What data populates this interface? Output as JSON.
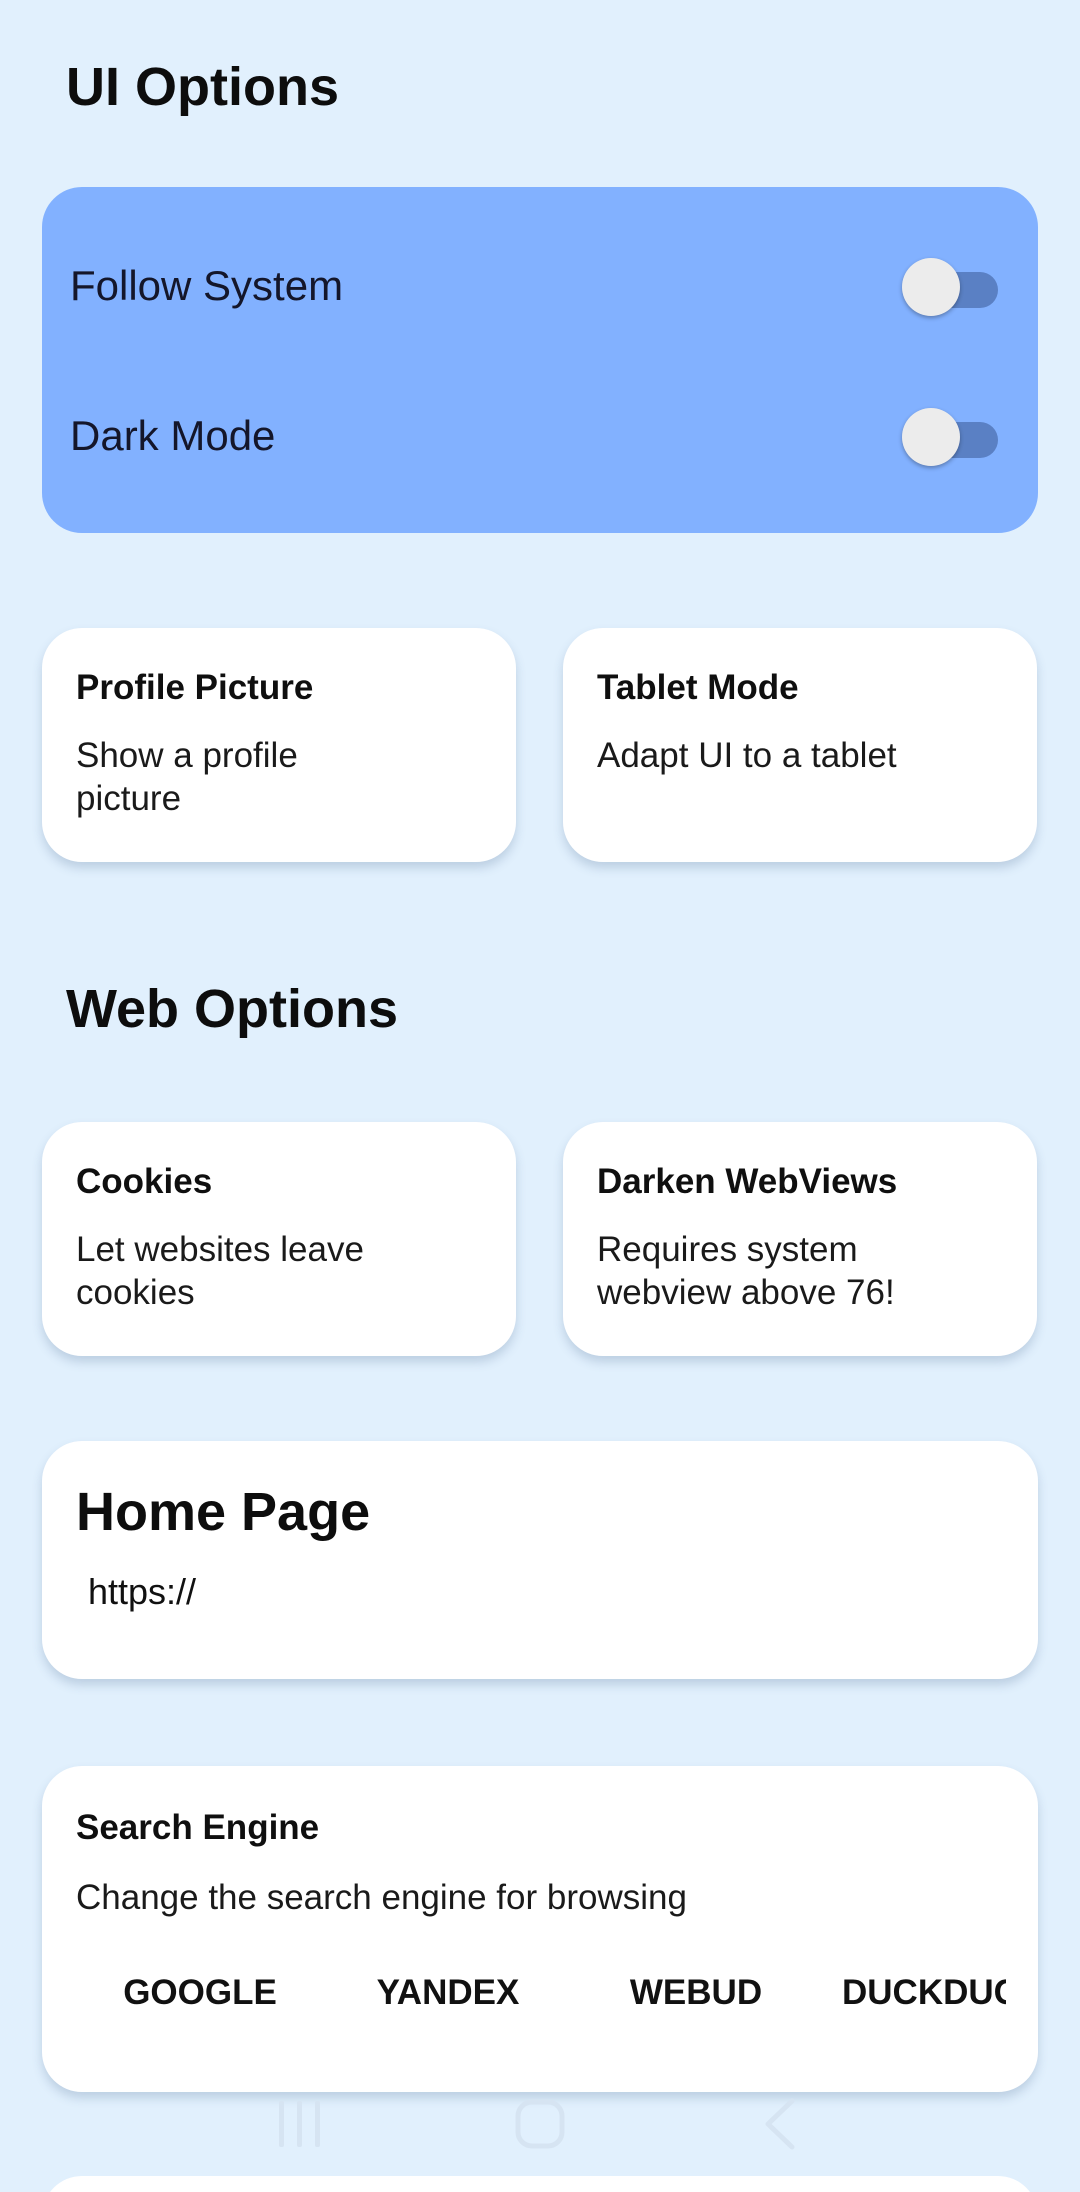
{
  "ui_options": {
    "title": "UI Options",
    "toggles": [
      {
        "label": "Follow System",
        "on": false
      },
      {
        "label": "Dark Mode",
        "on": false
      }
    ],
    "cards": [
      {
        "title": "Profile Picture",
        "desc": "Show a profile picture"
      },
      {
        "title": "Tablet Mode",
        "desc": "Adapt UI to a tablet"
      }
    ]
  },
  "web_options": {
    "title": "Web Options",
    "cards": [
      {
        "title": "Cookies",
        "desc": "Let websites leave cookies"
      },
      {
        "title": "Darken WebViews",
        "desc": "Requires system webview above 76!"
      }
    ],
    "home_page": {
      "title": "Home Page",
      "value": "https://"
    },
    "search_engine": {
      "title": "Search Engine",
      "desc": "Change the search engine for browsing",
      "options": [
        "GOOGLE",
        "YANDEX",
        "WEBUD",
        "DUCKDUCK"
      ]
    }
  },
  "navbar": {
    "icons": [
      "recent-apps-icon",
      "home-icon",
      "back-icon"
    ]
  },
  "colors": {
    "background": "#e1f0fd",
    "accent_card": "#82b1ff",
    "switch_track": "#5a80c4",
    "switch_thumb": "#ececec"
  }
}
